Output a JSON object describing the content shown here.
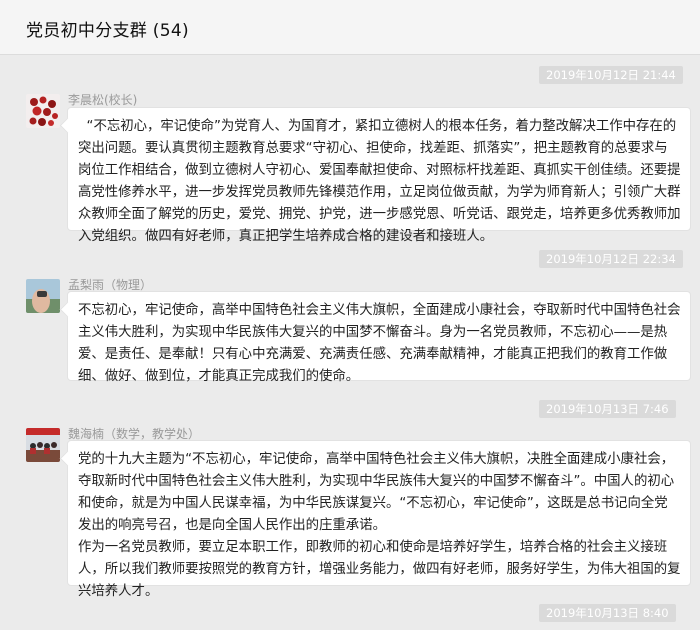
{
  "header": {
    "title": "党员初中分支群 (54)"
  },
  "messages": [
    {
      "timestamp": "2019年10月12日 21:44",
      "sender": "李晨松(校长)",
      "text": "  “不忘初心，牢记使命”为党育人、为国育才，紧扣立德树人的根本任务，着力整改解决工作中存在的突出问题。要认真贯彻主题教育总要求“守初心、担使命，找差距、抓落实”，把主题教育的总要求与岗位工作相结合，做到立德树人守初心、爱国奉献担使命、对照标杆找差距、真抓实干创佳绩。还要提高党性修养水平，进一步发挥党员教师先锋模范作用，立足岗位做贡献，为学为师育新人；引领广大群众教师全面了解党的历史，爱党、拥党、护党，进一步感党恩、听党话、跟党走，培养更多优秀教师加入党组织。做四有好老师，真正把学生培养成合格的建设者和接班人。"
    },
    {
      "timestamp": "2019年10月12日 22:34",
      "sender": "孟梨雨（物理）",
      "text": "不忘初心，牢记使命，高举中国特色社会主义伟大旗帜，全面建成小康社会，夺取新时代中国特色社会主义伟大胜利，为实现中华民族伟大复兴的中国梦不懈奋斗。身为一名党员教师，不忘初心——是热爱、是责任、是奉献！只有心中充满爱、充满责任感、充满奉献精神，才能真正把我们的教育工作做细、做好、做到位，才能真正完成我们的使命。"
    },
    {
      "timestamp": "2019年10月13日 7:46",
      "sender": "魏海楠（数学，教学处）",
      "text": "党的十九大主题为“不忘初心，牢记使命，高举中国特色社会主义伟大旗帜，决胜全面建成小康社会，夺取新时代中国特色社会主义伟大胜利，为实现中华民族伟大复兴的中国梦不懈奋斗”。中国人的初心和使命，就是为中国人民谋幸福，为中华民族谋复兴。“不忘初心，牢记使命”，这既是总书记向全党发出的响亮号召，也是向全国人民作出的庄重承诺。\n作为一名党员教师，要立足本职工作，即教师的初心和使命是培养好学生，培养合格的社会主义接班人，所以我们教师要按照党的教育方针，增强业务能力，做四有好老师，服务好学生，为伟大祖国的复兴培养人才。"
    }
  ],
  "next_timestamp": "2019年10月13日 8:40"
}
